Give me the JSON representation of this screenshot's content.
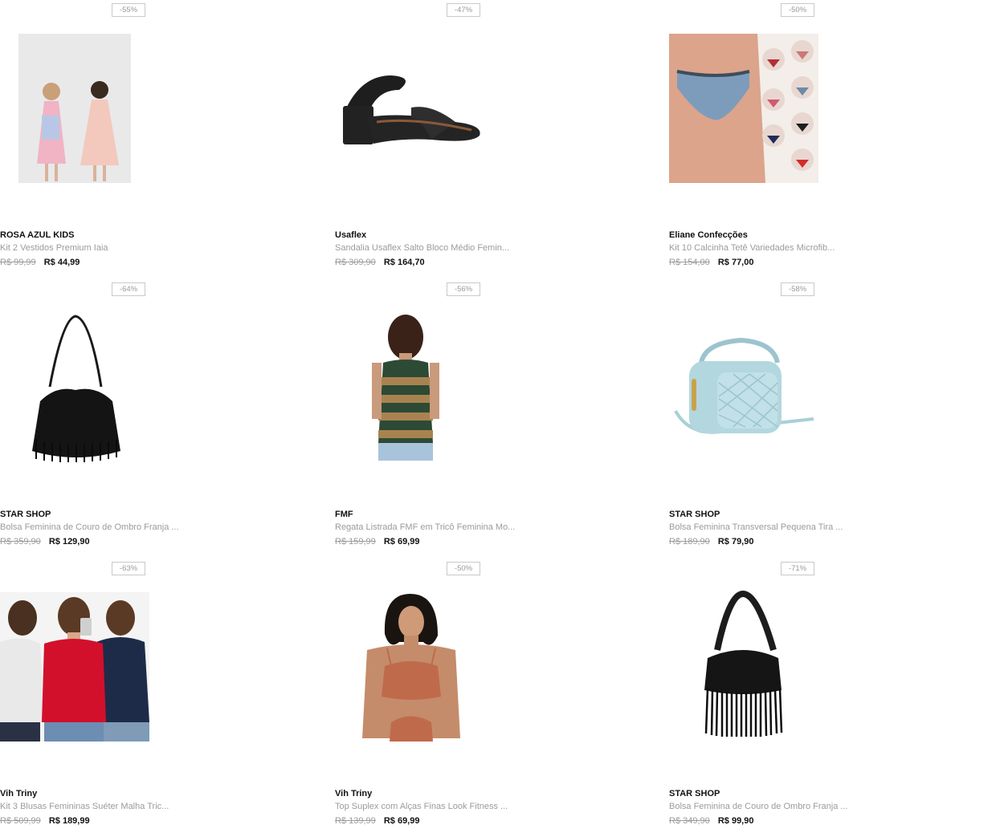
{
  "products": [
    {
      "discount": "-55%",
      "brand": "ROSA AZUL KIDS",
      "title": "Kit 2 Vestidos Premium Iaia",
      "old_price": "R$ 99,99",
      "price": "R$ 44,99",
      "image": "kids-dresses"
    },
    {
      "discount": "-47%",
      "brand": "Usaflex",
      "title": "Sandalia Usaflex Salto Bloco Médio Femin...",
      "old_price": "R$ 309,90",
      "price": "R$ 164,70",
      "image": "black-sandal"
    },
    {
      "discount": "-50%",
      "brand": "Eliane Confecções",
      "title": "Kit 10 Calcinha Tetê Variedades Microfib...",
      "old_price": "R$ 154,00",
      "price": "R$ 77,00",
      "image": "panties-kit"
    },
    {
      "discount": "-64%",
      "brand": "STAR SHOP",
      "title": "Bolsa Feminina de Couro de Ombro Franja ...",
      "old_price": "R$ 359,90",
      "price": "R$ 129,90",
      "image": "fringe-bag"
    },
    {
      "discount": "-56%",
      "brand": "FMF",
      "title": "Regata Listrada FMF em Tricô Feminina Mo...",
      "old_price": "R$ 159,99",
      "price": "R$ 69,99",
      "image": "striped-tank"
    },
    {
      "discount": "-58%",
      "brand": "STAR SHOP",
      "title": "Bolsa Feminina Transversal Pequena Tira ...",
      "old_price": "R$ 189,90",
      "price": "R$ 79,90",
      "image": "quilted-crossbody-bag"
    },
    {
      "discount": "-63%",
      "brand": "Vih Triny",
      "title": "Kit 3 Blusas Femininas Suéter Malha Tric...",
      "old_price": "R$ 509,99",
      "price": "R$ 189,99",
      "image": "three-sweaters"
    },
    {
      "discount": "-50%",
      "brand": "Vih Triny",
      "title": "Top Suplex com Alças Finas Look Fitness ...",
      "old_price": "R$ 139,99",
      "price": "R$ 69,99",
      "image": "fitness-top"
    },
    {
      "discount": "-71%",
      "brand": "STAR SHOP",
      "title": "Bolsa Feminina de Couro de Ombro Franja ...",
      "old_price": "R$ 349,90",
      "price": "R$ 99,90",
      "image": "fringe-bag-long"
    }
  ]
}
